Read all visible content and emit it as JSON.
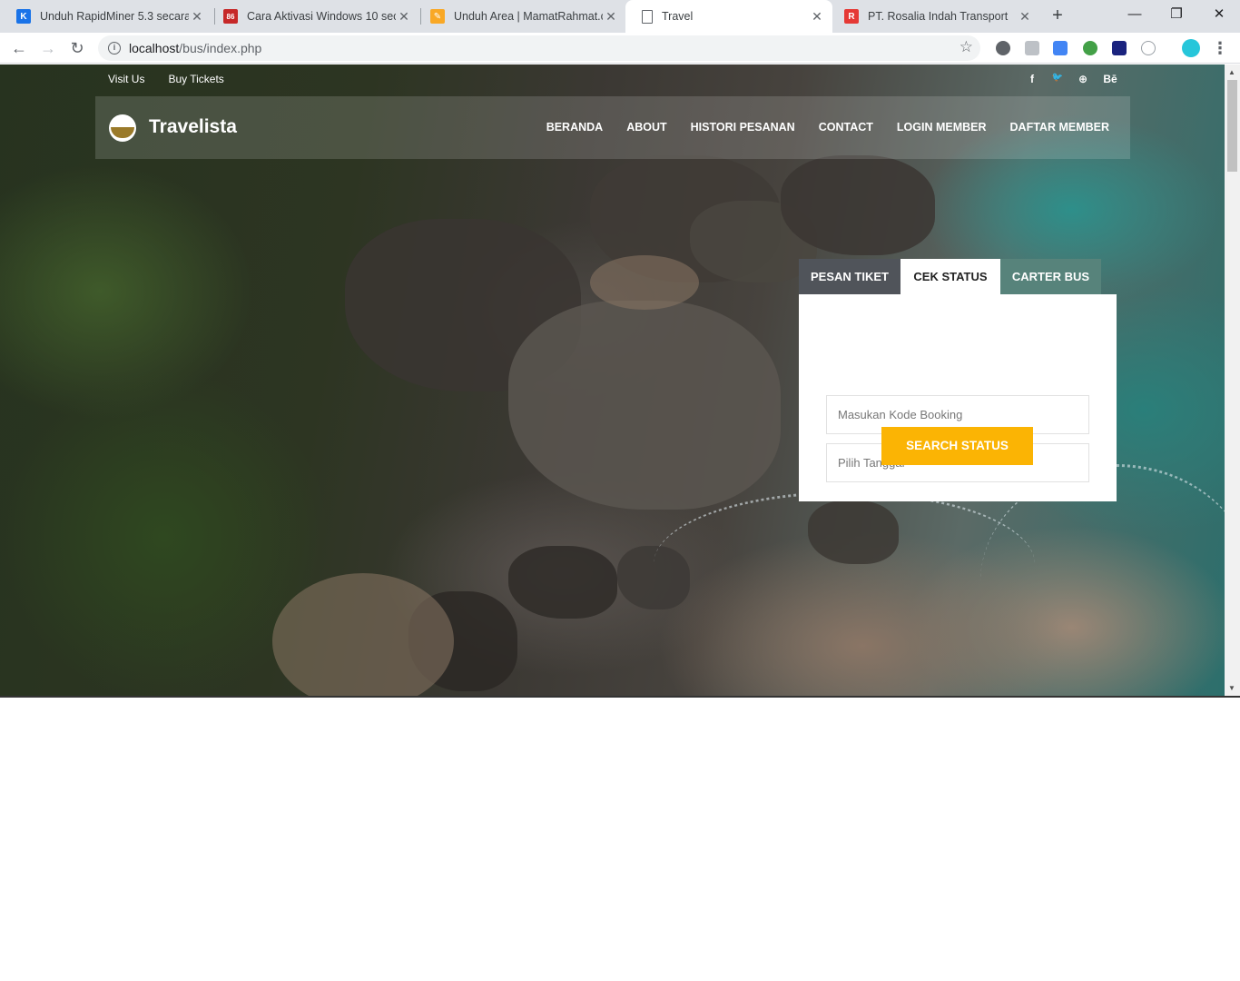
{
  "browser": {
    "tabs": [
      {
        "title": "Unduh RapidMiner 5.3 secara g",
        "close": "✕",
        "favicon_color": "#1a73e8",
        "favicon_glyph": "K"
      },
      {
        "title": "Cara Aktivasi Windows 10 seca",
        "close": "✕",
        "favicon_color": "#c62828",
        "favicon_glyph": "86"
      },
      {
        "title": "Unduh Area | MamatRahmat.co",
        "close": "✕",
        "favicon_color": "#f9a825",
        "favicon_glyph": "✎"
      },
      {
        "title": "Travel",
        "close": "✕",
        "favicon_color": "#ffffff",
        "favicon_glyph": "🗋"
      },
      {
        "title": "PT. Rosalia Indah Transport",
        "close": "✕",
        "favicon_color": "#e53935",
        "favicon_glyph": "R"
      }
    ],
    "new_tab": "+",
    "window_controls": {
      "minimize": "—",
      "restore": "❐",
      "close": "✕"
    },
    "nav": {
      "back": "←",
      "forward": "→",
      "reload": "↻"
    },
    "address": {
      "info": "i",
      "host": "localhost",
      "path": "/bus/index.php",
      "star": "☆"
    },
    "menu": "⋮"
  },
  "topbar": {
    "links": [
      "Visit Us",
      "Buy Tickets"
    ],
    "social": [
      "f",
      "🐦",
      "⊕",
      "Bē"
    ]
  },
  "navbar": {
    "brand": "Travelista",
    "menu": [
      "BERANDA",
      "ABOUT",
      "HISTORI PESANAN",
      "CONTACT",
      "LOGIN MEMBER",
      "DAFTAR MEMBER"
    ]
  },
  "booking": {
    "tabs": [
      "PESAN TIKET",
      "CEK STATUS",
      "CARTER BUS"
    ],
    "active_tab": "CEK STATUS",
    "booking_code_placeholder": "Masukan Kode Booking",
    "date_placeholder": "Pilih Tanggal",
    "submit_label": "SEARCH STATUS",
    "accent_color": "#fbb404"
  }
}
